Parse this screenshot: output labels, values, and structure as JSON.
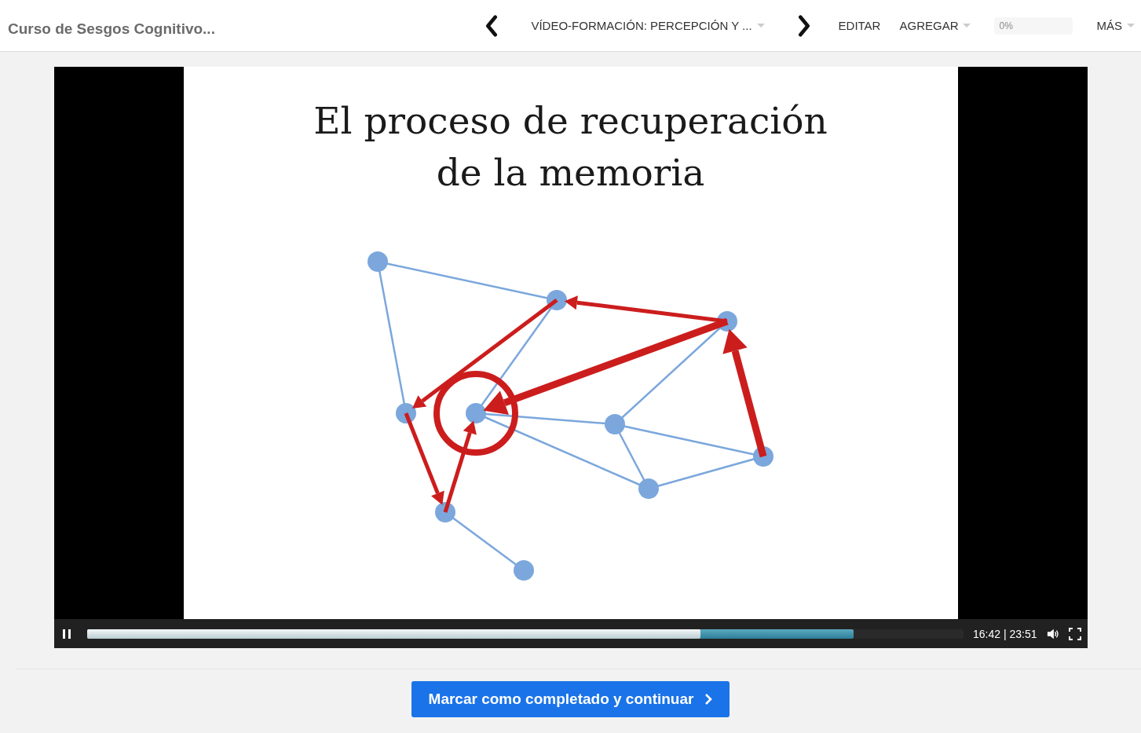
{
  "header": {
    "course_title": "Curso de Sesgos Cognitivo...",
    "lesson": {
      "label": "VÍDEO-FORMACIÓN: PERCEPCIÓN Y ...",
      "dropdown": true
    },
    "menu": [
      {
        "label": "EDITAR",
        "dropdown": false
      },
      {
        "label": "AGREGAR",
        "dropdown": true
      }
    ],
    "progress": {
      "label": "0%",
      "level": 0
    },
    "more": {
      "label": "MÁS",
      "dropdown": true
    }
  },
  "video": {
    "slide": {
      "title_lines": [
        "El proceso de recuperación",
        "de la memoria"
      ]
    },
    "playing": true,
    "played": {
      "level": 0.7
    },
    "buffer": {
      "level": 0.875
    },
    "time": "16:42 | 23:51",
    "muted": false
  },
  "complete_button": {
    "label": "Marcar como completado y continuar"
  }
}
